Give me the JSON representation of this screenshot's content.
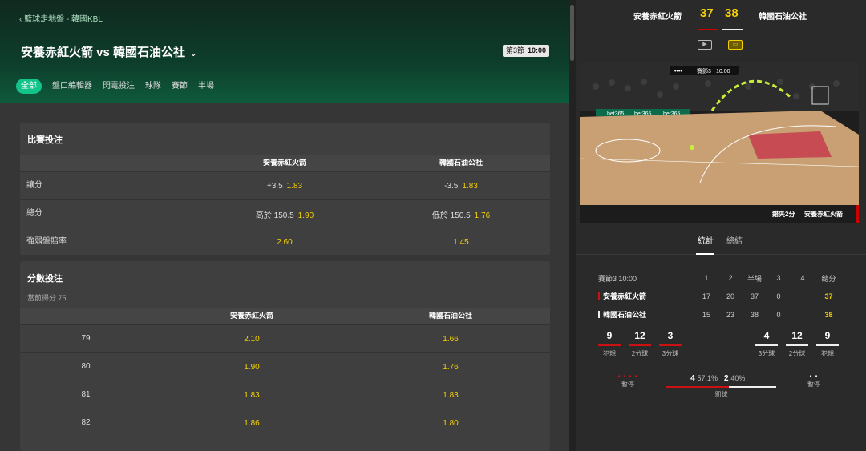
{
  "breadcrumb": "籃球走地盤 - 韓國KBL",
  "match_title": "安養赤紅火箭 vs 韓國石油公社",
  "clock": {
    "period": "第3節",
    "time": "10:00"
  },
  "nav_tabs": [
    "全部",
    "盤口編輯器",
    "閃電投注",
    "球隊",
    "賽節",
    "半場"
  ],
  "match_bets": {
    "title": "比賽投注",
    "home": "安養赤紅火箭",
    "away": "韓國石油公社",
    "rows": [
      {
        "label": "讓分",
        "home_line": "+3.5",
        "home_odds": "1.83",
        "away_line": "-3.5",
        "away_odds": "1.83"
      },
      {
        "label": "總分",
        "home_line": "高於 150.5",
        "home_odds": "1.90",
        "away_line": "低於 150.5",
        "away_odds": "1.76"
      },
      {
        "label": "強弱盤賠率",
        "home_line": "",
        "home_odds": "2.60",
        "away_line": "",
        "away_odds": "1.45"
      }
    ]
  },
  "score_bets": {
    "title": "分數投注",
    "current": "當前得分 75",
    "home": "安養赤紅火箭",
    "away": "韓國石油公社",
    "rows": [
      {
        "score": "79",
        "home": "2.10",
        "away": "1.66"
      },
      {
        "score": "80",
        "home": "1.90",
        "away": "1.76"
      },
      {
        "score": "81",
        "home": "1.83",
        "away": "1.83"
      },
      {
        "score": "82",
        "home": "1.86",
        "away": "1.80"
      }
    ]
  },
  "scoreboard": {
    "home": "安養赤紅火箭",
    "away": "韓國石油公社",
    "home_score": "37",
    "away_score": "38"
  },
  "view_icons": [
    "video-icon",
    "court-icon"
  ],
  "court_view": {
    "period": "賽節3",
    "time": "10:00",
    "event": "錯失2分",
    "event_team": "安養赤紅火箭",
    "sponsor": "bet365"
  },
  "stat_tabs": [
    "統計",
    "總結"
  ],
  "quarter_table": {
    "head": {
      "period": "賽節3",
      "time": "10:00",
      "q1": "1",
      "q2": "2",
      "half": "半場",
      "q3": "3",
      "q4": "4",
      "total": "總分"
    },
    "rows": [
      {
        "team": "安養赤紅火箭",
        "q1": "17",
        "q2": "20",
        "half": "37",
        "q3": "0",
        "total": "37",
        "color": "#cc1111"
      },
      {
        "team": "韓國石油公社",
        "q1": "15",
        "q2": "23",
        "half": "38",
        "q3": "0",
        "total": "38",
        "color": "#eeeeee"
      }
    ]
  },
  "home_stats": [
    {
      "value": "9",
      "label": "犯規"
    },
    {
      "value": "12",
      "label": "2分球"
    },
    {
      "value": "3",
      "label": "3分球"
    }
  ],
  "away_stats": [
    {
      "value": "4",
      "label": "3分球"
    },
    {
      "value": "12",
      "label": "2分球"
    },
    {
      "value": "9",
      "label": "犯規"
    }
  ],
  "timeouts": {
    "label": "暫停",
    "home_dots": "• • • •",
    "away_dots": "• •"
  },
  "possession": {
    "label": "罰球",
    "home": "4",
    "home_pct": "57.1%",
    "home_fraction": 0.571,
    "away": "2",
    "away_pct": "40%"
  }
}
